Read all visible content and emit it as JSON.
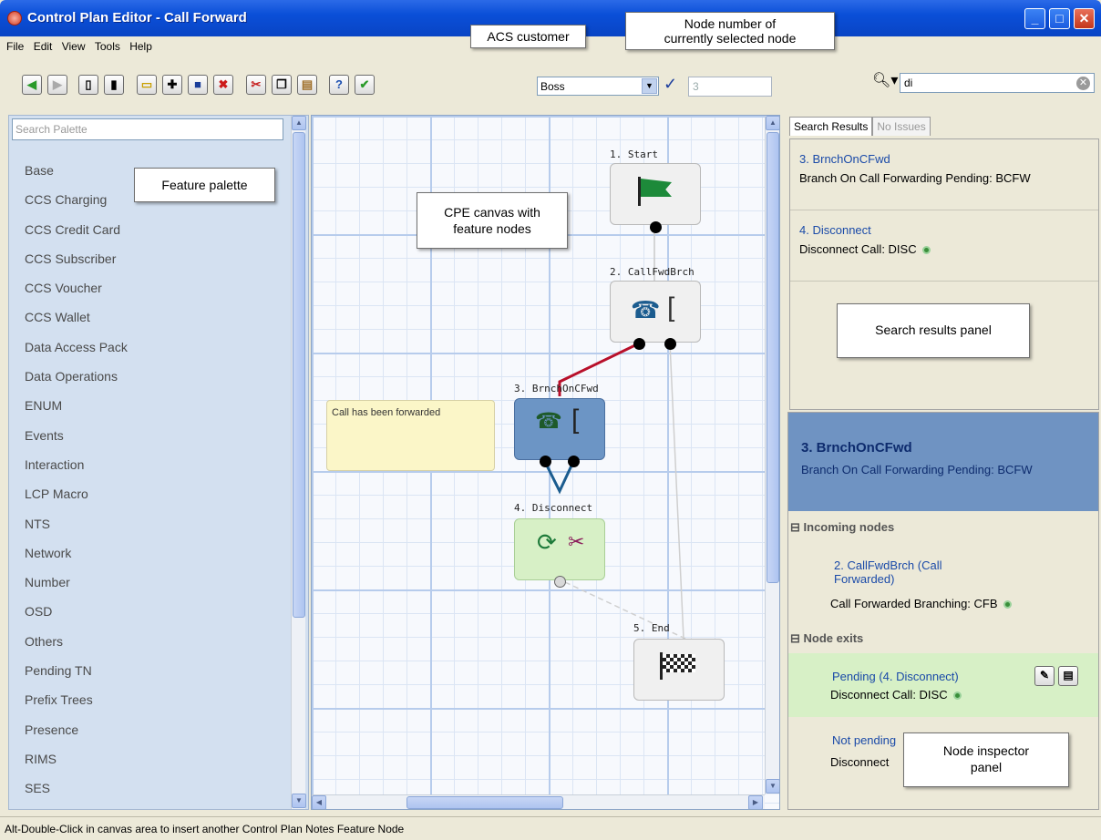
{
  "window": {
    "title": "Control Plan Editor - Call Forward"
  },
  "menu": [
    "File",
    "Edit",
    "View",
    "Tools",
    "Help"
  ],
  "toolbar": {
    "customer": "Boss",
    "node_number": "3",
    "search_value": "di"
  },
  "palette": {
    "placeholder": "Search Palette",
    "items": [
      "Base",
      "CCS Charging",
      "CCS Credit Card",
      "CCS Subscriber",
      "CCS Voucher",
      "CCS Wallet",
      "Data Access Pack",
      "Data Operations",
      "ENUM",
      "Events",
      "Interaction",
      "LCP Macro",
      "NTS",
      "Network",
      "Number",
      "OSD",
      "Others",
      "Pending TN",
      "Prefix Trees",
      "Presence",
      "RIMS",
      "SES"
    ]
  },
  "canvas": {
    "nodes": [
      "1. Start",
      "2. CallFwdBrch",
      "3. BrnchOnCFwd",
      "4. Disconnect",
      "5. End"
    ],
    "note": "Call has been forwarded"
  },
  "results": {
    "tabs": [
      "Search Results",
      "No Issues"
    ],
    "items": [
      {
        "name": "3. BrnchOnCFwd",
        "desc": "Branch On Call Forwarding Pending: BCFW"
      },
      {
        "name": "4. Disconnect",
        "desc": "Disconnect Call: DISC"
      }
    ]
  },
  "inspector": {
    "name": "3. BrnchOnCFwd",
    "desc": "Branch On Call Forwarding Pending: BCFW",
    "incoming_title": "Incoming nodes",
    "incoming_name_1": "2. CallFwdBrch (Call",
    "incoming_name_2": "Forwarded)",
    "incoming_desc": "Call Forwarded Branching: CFB",
    "exits_title": "Node exits",
    "exit1_name": "Pending (4. Disconnect)",
    "exit1_desc": "Disconnect Call: DISC",
    "exit2_name": "Not pending",
    "exit2_desc": "Disconnect"
  },
  "annotations": {
    "acs_customer": "ACS customer",
    "node_number_1": "Node number of",
    "node_number_2": "currently selected node",
    "feature_palette": "Feature palette",
    "canvas_1": "CPE canvas with",
    "canvas_2": "feature nodes",
    "search_results": "Search results panel",
    "inspector_1": "Node inspector",
    "inspector_2": "panel"
  },
  "status": "Alt-Double-Click in canvas area to insert another Control Plan Notes Feature Node"
}
